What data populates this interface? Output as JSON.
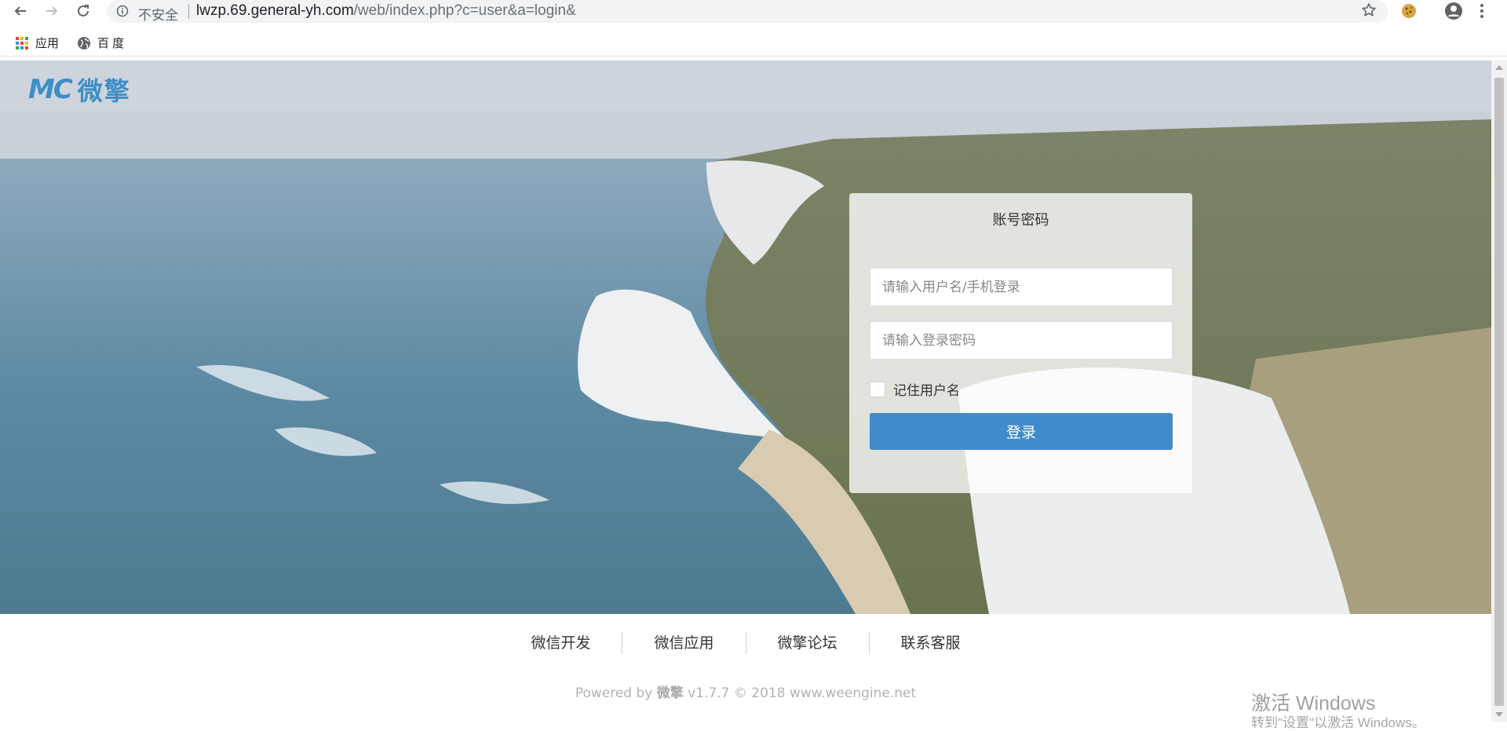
{
  "browser": {
    "security_label": "不安全",
    "url_host": "lwzp.69.general-yh.com",
    "url_path": "/web/index.php?c=user&a=login&",
    "bookmarks": [
      {
        "label": "应用",
        "icon": "apps-grid-icon"
      },
      {
        "label": "百 度",
        "icon": "globe-icon"
      }
    ]
  },
  "header": {
    "logo_mark": "MC",
    "logo_text": "微擎"
  },
  "login": {
    "title": "账号密码",
    "username_placeholder": "请输入用户名/手机登录",
    "password_placeholder": "请输入登录密码",
    "remember_label": "记住用户名",
    "submit_label": "登录",
    "accent_color": "#428bca"
  },
  "footer": {
    "links": [
      "微信开发",
      "微信应用",
      "微擎论坛",
      "联系客服"
    ],
    "copyright_prefix": "Powered by ",
    "copyright_brand": "微擎",
    "copyright_suffix": " v1.7.7 © 2018 www.weengine.net"
  },
  "watermark": {
    "line1": "激活 Windows",
    "line2": "转到\"设置\"以激活 Windows。"
  }
}
